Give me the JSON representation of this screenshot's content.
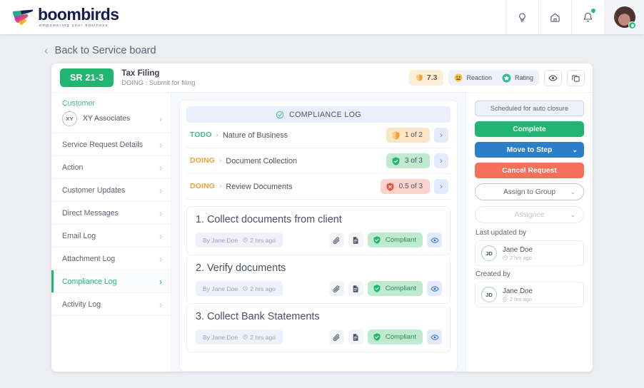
{
  "brand": {
    "name": "boombirds",
    "tagline": "empowering your business"
  },
  "topbar": {
    "icons": [
      {
        "name": "lightbulb-icon",
        "label": "Tips"
      },
      {
        "name": "home-icon",
        "label": "Home"
      },
      {
        "name": "bell-icon",
        "label": "Notifications"
      }
    ],
    "avatar_name": "user-avatar"
  },
  "back_link": {
    "label": "Back to Service board",
    "chevron": "‹"
  },
  "service_request": {
    "badge": "SR 21-3",
    "title": "Tax Filing",
    "subtitle": "DOING : Submit for filing",
    "score": "7.3",
    "reaction_label": "Reaction",
    "rating_label": "Rating"
  },
  "left_nav": {
    "customer_caption": "Customer",
    "customer_initials": "XY",
    "customer_name": "XY Associates",
    "items": [
      {
        "label": "Service Request Details",
        "active": false
      },
      {
        "label": "Action",
        "active": false
      },
      {
        "label": "Customer Updates",
        "active": false
      },
      {
        "label": "Direct Messages",
        "active": false
      },
      {
        "label": "Email Log",
        "active": false
      },
      {
        "label": "Attachment Log",
        "active": false
      },
      {
        "label": "Compliance Log",
        "active": true
      },
      {
        "label": "Activity Log",
        "active": false
      }
    ],
    "chevron": "›"
  },
  "compliance": {
    "header": "COMPLIANCE LOG",
    "rows": [
      {
        "state": "TODO",
        "state_class": "todo",
        "sep": "›",
        "name": "Nature of Business",
        "count": "1 of 2",
        "pill_class": "orange",
        "shield": "plain"
      },
      {
        "state": "DOING",
        "state_class": "doing",
        "sep": "›",
        "name": "Document Collection",
        "count": "3 of 3",
        "pill_class": "green",
        "shield": "check"
      },
      {
        "state": "DOING",
        "state_class": "doing",
        "sep": "›",
        "name": "Review Documents",
        "count": "0.5 of 3",
        "pill_class": "red",
        "shield": "cross"
      }
    ],
    "go_arrow": "›",
    "tasks": [
      {
        "title": "1. Collect documents from client",
        "author": "By Jane Doe",
        "time": "2 hrs ago",
        "status": "Compliant"
      },
      {
        "title": "2. Verify documents",
        "author": "By Jane Doe",
        "time": "2 hrs ago",
        "status": "Compliant"
      },
      {
        "title": "3. Collect Bank Statements",
        "author": "By Jane Doe",
        "time": "2 hrs ago",
        "status": "Compliant"
      }
    ]
  },
  "right_panel": {
    "scheduled_label": "Scheduled for auto closure",
    "complete_label": "Complete",
    "move_label": "Move to Step",
    "cancel_label": "Cancel Request",
    "assign_group_label": "Assign to Group",
    "assignee_label": "Assignee",
    "caret": "⌄",
    "last_updated_label": "Last updated by",
    "last_updated": {
      "initials": "JD",
      "name": "Jane Doe",
      "time": "2 hrs ago"
    },
    "created_label": "Created by",
    "created": {
      "initials": "JD",
      "name": "Jane Doe",
      "time": "2 hrs ago"
    }
  },
  "colors": {
    "brand_green": "#21b573",
    "blue": "#2b7fc9",
    "red": "#f4705a",
    "orange": "#f0a136"
  }
}
